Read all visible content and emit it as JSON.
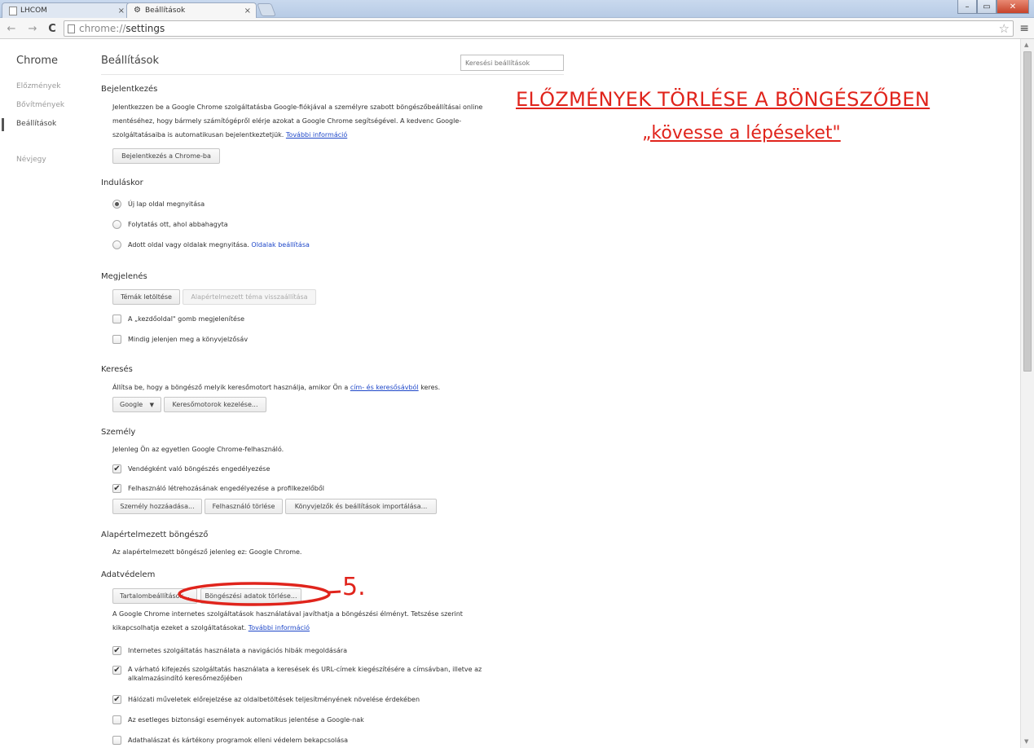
{
  "tabs": [
    {
      "title": "LHCOM",
      "close": "×"
    },
    {
      "title": "Beállítások",
      "close": "×"
    }
  ],
  "window_controls": {
    "minimize": "–",
    "restore": "▭",
    "close": "✕"
  },
  "toolbar": {
    "back": "←",
    "forward": "→",
    "reload": "C",
    "url_scheme": "chrome://",
    "url_path": "settings",
    "star": "☆",
    "menu": "≡"
  },
  "leftnav": {
    "brand": "Chrome",
    "items": [
      "Előzmények",
      "Bővítmények",
      "Beállítások",
      "Névjegy"
    ],
    "selected": "Beállítások"
  },
  "header": {
    "title": "Beállítások",
    "search_placeholder": "Keresési beállítások"
  },
  "signin": {
    "heading": "Bejelentkezés",
    "text": "Jelentkezzen be a Google Chrome szolgáltatásba Google-fiókjával a személyre szabott böngészőbeállításai online mentéséhez, hogy bármely számítógépről elérje azokat a Google Chrome segítségével. A kedvenc Google-szolgáltatásaiba is automatikusan bejelentkeztetjük.",
    "link": "További információ",
    "button": "Bejelentkezés a Chrome-ba"
  },
  "startup": {
    "heading": "Induláskor",
    "options": [
      "Új lap oldal megnyitása",
      "Folytatás ott, ahol abbahagyta",
      "Adott oldal vagy oldalak megnyitása."
    ],
    "selected_index": 0,
    "pages_link": "Oldalak beállítása"
  },
  "appearance": {
    "heading": "Megjelenés",
    "themes_button": "Témák letöltése",
    "reset_button": "Alapértelmezett téma visszaállítása",
    "checks": [
      {
        "label": "A „kezdőoldal\" gomb megjelenítése",
        "checked": false
      },
      {
        "label": "Mindig jelenjen meg a könyvjelzősáv",
        "checked": false
      }
    ]
  },
  "search": {
    "heading": "Keresés",
    "text_before": "Állítsa be, hogy a böngésző melyik keresőmotort használja, amikor Ön a",
    "link": "cím- és keresősávból",
    "text_after": "keres.",
    "engine": "Google",
    "manage_button": "Keresőmotorok kezelése..."
  },
  "people": {
    "heading": "Személy",
    "text": "Jelenleg Ön az egyetlen Google Chrome-felhasználó.",
    "checks": [
      {
        "label": "Vendégként való böngészés engedélyezése",
        "checked": true
      },
      {
        "label": "Felhasználó létrehozásának engedélyezése a profilkezelőből",
        "checked": true
      }
    ],
    "buttons": [
      "Személy hozzáadása...",
      "Felhasználó törlése",
      "Könyvjelzők és beállítások importálása..."
    ]
  },
  "default_browser": {
    "heading": "Alapértelmezett böngésző",
    "text": "Az alapértelmezett böngésző jelenleg ez: Google Chrome."
  },
  "privacy": {
    "heading": "Adatvédelem",
    "content_button": "Tartalombeállítások...",
    "clear_button": "Böngészési adatok törlése...",
    "text": "A Google Chrome internetes szolgáltatások használatával javíthatja a böngészési élményt. Tetszése szerint kikapcsolhatja ezeket a szolgáltatásokat.",
    "link": "További információ",
    "checks": [
      {
        "label": "Internetes szolgáltatás használata a navigációs hibák megoldására",
        "checked": true
      },
      {
        "label": "A várható kifejezés szolgáltatás használata a keresések és URL-címek kiegészítésére a címsávban, illetve az alkalmazásindító keresőmezőjében",
        "checked": true
      },
      {
        "label": "Hálózati műveletek előrejelzése az oldalbetöltések teljesítményének növelése érdekében",
        "checked": true
      },
      {
        "label": "Az esetleges biztonsági események automatikus jelentése a Google-nak",
        "checked": false
      },
      {
        "label": "Adathalászat és kártékony programok elleni védelem bekapcsolása",
        "checked": false
      }
    ]
  },
  "annotation": {
    "title": "ELŐZMÉNYEK TÖRLÉSE A BÖNGÉSZŐBEN",
    "subtitle": "„kövesse a lépéseket\"",
    "step": "5.",
    "color": "#e0241c"
  },
  "scrollbar": {
    "up": "▲",
    "down": "▼"
  }
}
